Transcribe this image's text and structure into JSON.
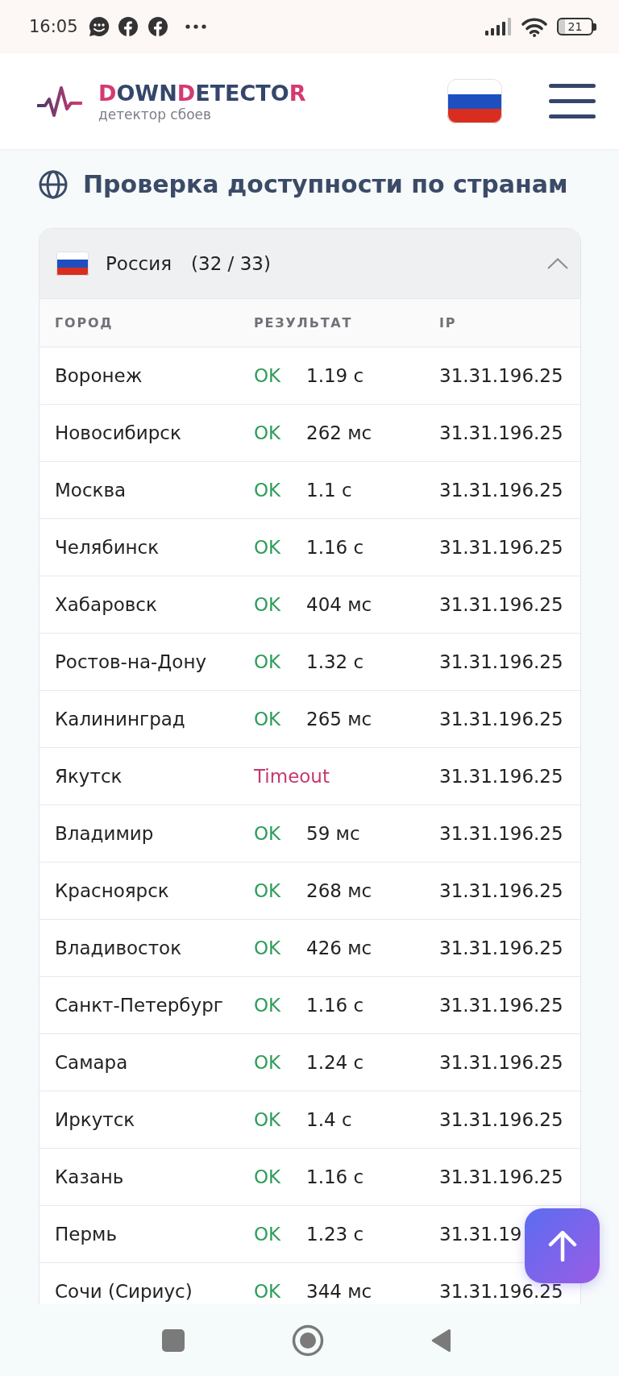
{
  "status_bar": {
    "time": "16:05",
    "battery": "21"
  },
  "header": {
    "logo": {
      "wordmark": [
        {
          "text": "D",
          "accent": true
        },
        {
          "text": "OWN",
          "accent": false
        },
        {
          "text": "D",
          "accent": true
        },
        {
          "text": "ETECTO",
          "accent": false
        },
        {
          "text": "R",
          "accent": true
        }
      ],
      "tagline": "детектор сбоев"
    }
  },
  "section": {
    "title": "Проверка доступности по странам"
  },
  "countries": [
    {
      "name": "Россия",
      "count": "(32 / 33)",
      "expanded": true,
      "table": {
        "columns": [
          "ГОРОД",
          "РЕЗУЛЬТАТ",
          "IP"
        ],
        "rows": [
          {
            "city": "Воронеж",
            "kind": "ok",
            "result": "OK",
            "time": "1.19 с",
            "ip": "31.31.196.25"
          },
          {
            "city": "Новосибирск",
            "kind": "ok",
            "result": "OK",
            "time": "262 мс",
            "ip": "31.31.196.25"
          },
          {
            "city": "Москва",
            "kind": "ok",
            "result": "OK",
            "time": "1.1 с",
            "ip": "31.31.196.25"
          },
          {
            "city": "Челябинск",
            "kind": "ok",
            "result": "OK",
            "time": "1.16 с",
            "ip": "31.31.196.25"
          },
          {
            "city": "Хабаровск",
            "kind": "ok",
            "result": "OK",
            "time": "404 мс",
            "ip": "31.31.196.25"
          },
          {
            "city": "Ростов-на-Дону",
            "kind": "ok",
            "result": "OK",
            "time": "1.32 с",
            "ip": "31.31.196.25"
          },
          {
            "city": "Калининград",
            "kind": "ok",
            "result": "OK",
            "time": "265 мс",
            "ip": "31.31.196.25"
          },
          {
            "city": "Якутск",
            "kind": "timeout",
            "result": "Timeout",
            "ip": "31.31.196.25"
          },
          {
            "city": "Владимир",
            "kind": "ok",
            "result": "OK",
            "time": "59 мс",
            "ip": "31.31.196.25"
          },
          {
            "city": "Красноярск",
            "kind": "ok",
            "result": "OK",
            "time": "268 мс",
            "ip": "31.31.196.25"
          },
          {
            "city": "Владивосток",
            "kind": "ok",
            "result": "OK",
            "time": "426 мс",
            "ip": "31.31.196.25"
          },
          {
            "city": "Санкт-Петербург",
            "kind": "ok",
            "result": "OK",
            "time": "1.16 с",
            "ip": "31.31.196.25"
          },
          {
            "city": "Самара",
            "kind": "ok",
            "result": "OK",
            "time": "1.24 с",
            "ip": "31.31.196.25"
          },
          {
            "city": "Иркутск",
            "kind": "ok",
            "result": "OK",
            "time": "1.4 с",
            "ip": "31.31.196.25"
          },
          {
            "city": "Казань",
            "kind": "ok",
            "result": "OK",
            "time": "1.16 с",
            "ip": "31.31.196.25"
          },
          {
            "city": "Пермь",
            "kind": "ok",
            "result": "OK",
            "time": "1.23 с",
            "ip": "31.31.19"
          },
          {
            "city": "Сочи (Сириус)",
            "kind": "ok",
            "result": "OK",
            "time": "344 мс",
            "ip": "31.31.196.25"
          }
        ]
      }
    }
  ]
}
